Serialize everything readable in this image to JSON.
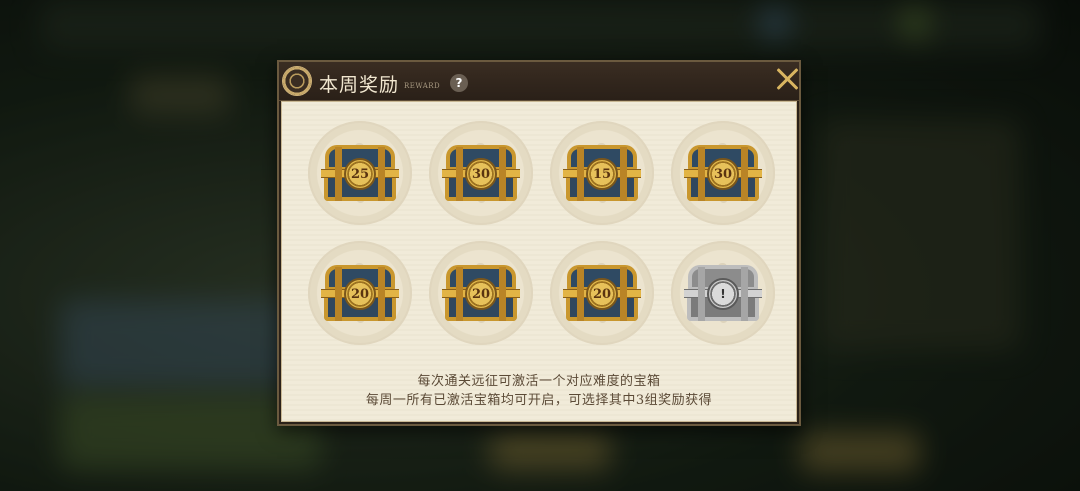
{
  "header": {
    "title": "本周奖励",
    "subtitle": "REWARD",
    "help_label": "?"
  },
  "chests": [
    {
      "label": "25",
      "tier": "gold"
    },
    {
      "label": "30",
      "tier": "gold"
    },
    {
      "label": "15",
      "tier": "gold"
    },
    {
      "label": "30",
      "tier": "gold"
    },
    {
      "label": "20",
      "tier": "gold"
    },
    {
      "label": "20",
      "tier": "gold"
    },
    {
      "label": "20",
      "tier": "gold"
    },
    {
      "label": "!",
      "tier": "silver"
    }
  ],
  "description": {
    "line1": "每次通关远征可激活一个对应难度的宝箱",
    "line2": "每周一所有已激活宝箱均可开启，可选择其中3组奖励获得"
  },
  "colors": {
    "accent_gold": "#d9b560",
    "panel_bg": "#f1ebd9",
    "frame": "#2b2119"
  }
}
